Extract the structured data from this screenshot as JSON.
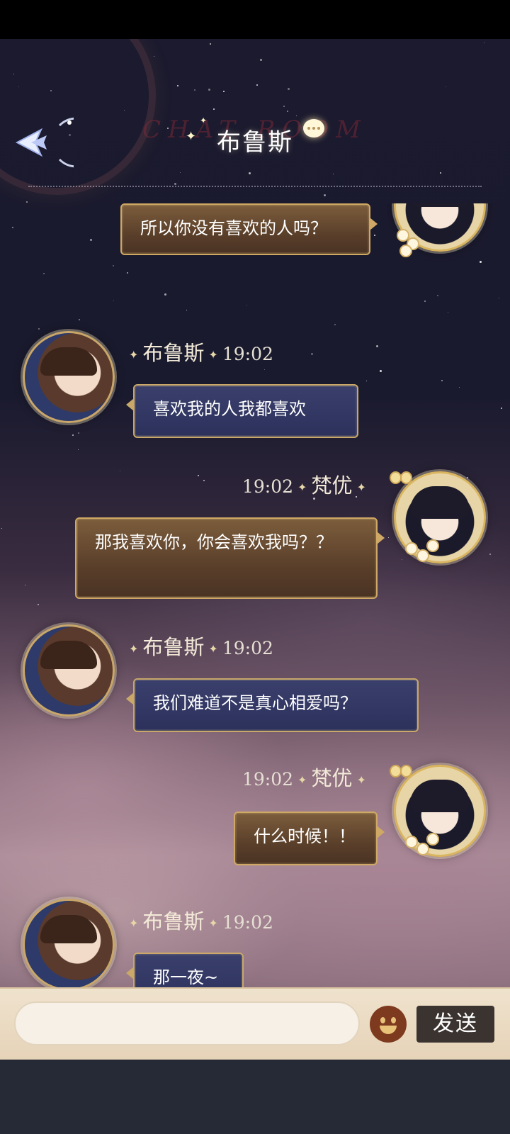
{
  "header": {
    "title": "布鲁斯",
    "background_text": "CHAT ROOM",
    "back_icon": "back-arrow-icon",
    "chat_icon": "speech-bubble-icon"
  },
  "messages": [
    {
      "sender": "梵优",
      "side": "right",
      "text": "所以你没有喜欢的人吗？"
    },
    {
      "sender": "布鲁斯",
      "time": "19:02",
      "side": "left",
      "text": "喜欢我的人我都喜欢"
    },
    {
      "sender": "梵优",
      "time": "19:02",
      "side": "right",
      "text": "那我喜欢你，你会喜欢我吗？？"
    },
    {
      "sender": "布鲁斯",
      "time": "19:02",
      "side": "left",
      "text": "我们难道不是真心相爱吗？"
    },
    {
      "sender": "梵优",
      "time": "19:02",
      "side": "right",
      "text": "什么时候！！"
    },
    {
      "sender": "布鲁斯",
      "time": "19:02",
      "side": "left",
      "text": "那一夜~"
    }
  ],
  "input": {
    "value": "",
    "placeholder": "",
    "emoji_icon": "smiley-face-icon",
    "send_label": "发送"
  },
  "colors": {
    "gold_border": "#cfa865",
    "blue_bubble": "#2c315c",
    "brown_bubble": "#5a3f2a",
    "send_button": "#3a3330",
    "input_bar": "#efe2cd"
  }
}
